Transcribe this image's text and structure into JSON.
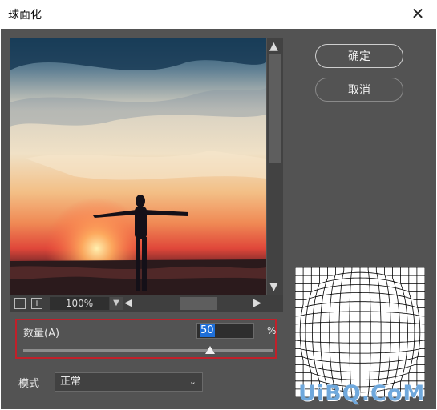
{
  "window": {
    "title": "球面化"
  },
  "buttons": {
    "ok": "确定",
    "cancel": "取消"
  },
  "preview": {
    "zoom": "100%"
  },
  "amount": {
    "label": "数量(A)",
    "value": "50",
    "unit": "%",
    "slider_fraction": 0.75
  },
  "mode": {
    "label": "模式",
    "selected": "正常"
  },
  "watermark": "UiBQ.CoM",
  "colors": {
    "highlight_border": "#c0202a",
    "selection": "#1e6fd9",
    "dialog_bg": "#535353"
  }
}
